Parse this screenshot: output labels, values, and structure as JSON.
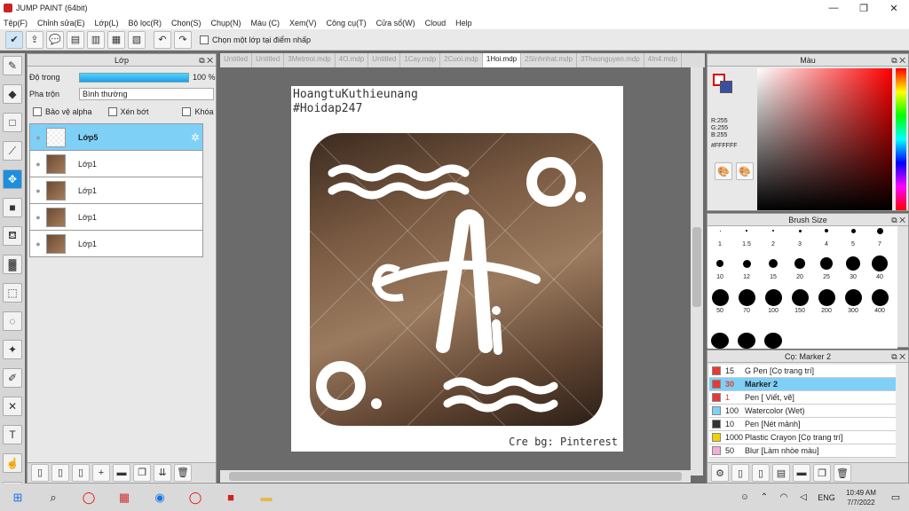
{
  "window": {
    "title": "JUMP PAINT (64bit)",
    "min": "—",
    "max": "❐",
    "close": "✕"
  },
  "menu": [
    "Tệp(F)",
    "Chỉnh sửa(E)",
    "Lớp(L)",
    "Bộ lọc(R)",
    "Chọn(S)",
    "Chụp(N)",
    "Màu (C)",
    "Xem(V)",
    "Công cụ(T)",
    "Cửa sổ(W)",
    "Cloud",
    "Help"
  ],
  "toolbar": {
    "checkbox_label": "Chọn một lớp tại điểm nhấp"
  },
  "layers": {
    "title": "Lớp",
    "opacity_label": "Độ trong",
    "opacity_value": "100 %",
    "blend_label": "Pha trộn",
    "blend_value": "Bình thường",
    "protect_alpha": "Bảo vệ alpha",
    "clip": "Xén bớt",
    "lock": "Khóa",
    "items": [
      {
        "name": "Lớp5"
      },
      {
        "name": "Lớp1"
      },
      {
        "name": "Lớp1"
      },
      {
        "name": "Lớp1"
      },
      {
        "name": "Lớp1"
      }
    ]
  },
  "tabs": [
    "Untitled",
    "Untitled",
    "3Metmoi.mdp",
    "4O.mdp",
    "Untitled",
    "1Cay.mdp",
    "2Cuoi.mdp",
    "1Hoi.mdp",
    "2Sinhnhat.mdp",
    "3Thaonguyen.mdp",
    "4In4.mdp"
  ],
  "active_tab": "1Hoi.mdp",
  "canvas": {
    "line1": "HoangtuKuthieunang",
    "line2": "#Hoidap247",
    "credit": "Cre bg: Pinterest"
  },
  "color": {
    "title": "Màu",
    "r": "R:255",
    "g": "G:255",
    "b": "B:255",
    "hex": "#FFFFFF"
  },
  "brush": {
    "title": "Brush Size",
    "sizes": [
      "1",
      "1.5",
      "2",
      "3",
      "4",
      "5",
      "7",
      "10",
      "12",
      "15",
      "20",
      "25",
      "30",
      "40",
      "50",
      "70",
      "100",
      "150",
      "200",
      "300",
      "400"
    ]
  },
  "subtool": {
    "title": "Cọ: Marker 2",
    "items": [
      {
        "num": "15",
        "label": "G Pen [Cọ trang trí]",
        "color": "#e53935"
      },
      {
        "num": "30",
        "label": "Marker 2",
        "color": "#e53935"
      },
      {
        "num": "1",
        "label": "Pen [ Viết, vẽ]",
        "color": "#e53935"
      },
      {
        "num": "100",
        "label": "Watercolor (Wet)",
        "color": "#7fd0f6"
      },
      {
        "num": "10",
        "label": "Pen [Nét mảnh]",
        "color": "#333333"
      },
      {
        "num": "1000",
        "label": "Plastic Crayon [Cọ trang trí]",
        "color": "#f0d000"
      },
      {
        "num": "50",
        "label": "Blur [Làm nhòe màu]",
        "color": "#f0b0d0"
      }
    ]
  },
  "taskbar": {
    "time": "10:49 AM",
    "date": "7/7/2022",
    "lang": "ENG"
  }
}
